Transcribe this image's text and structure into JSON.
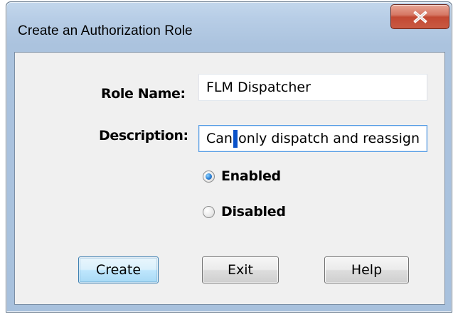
{
  "window": {
    "title": "Create an Authorization Role",
    "close_glyph": "X"
  },
  "form": {
    "role_name_label": "Role Name:",
    "role_name_value": "FLM Dispatcher",
    "description_label": "Description:",
    "description_value_before_caret": "Can",
    "description_value_after_caret": "only dispatch and reassign"
  },
  "status": {
    "selected": "Enabled",
    "options": [
      {
        "label": "Enabled",
        "checked": true
      },
      {
        "label": "Disabled",
        "checked": false
      }
    ]
  },
  "buttons": {
    "create_label": "Create",
    "exit_label": "Exit",
    "help_label": "Help"
  },
  "colors": {
    "title_bar": "#b7cde6",
    "client_background": "#f0f0f0",
    "close_button": "#c24832",
    "default_button_border": "#3c7fb1",
    "focus_border": "#569de5",
    "caret": "#0a52c9"
  },
  "icons": {
    "close": "close-icon",
    "radio_selected": "radio-selected-icon",
    "radio_unselected": "radio-unselected-icon"
  }
}
